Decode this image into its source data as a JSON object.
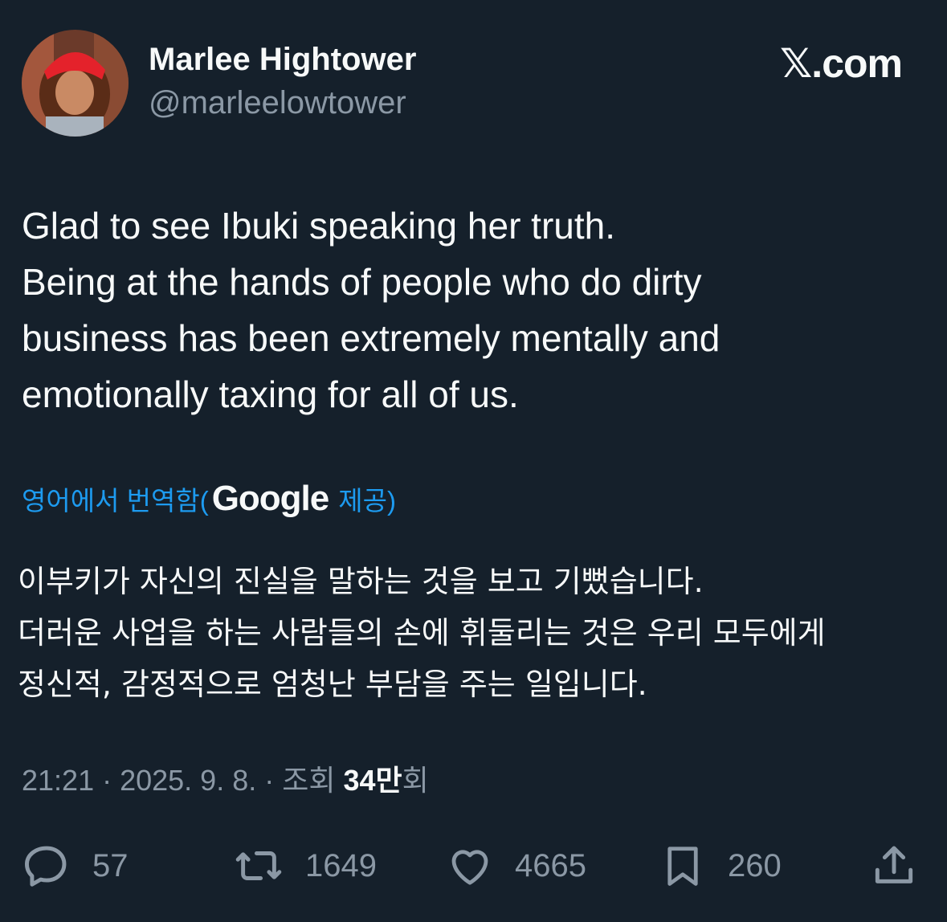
{
  "author": {
    "name": "Marlee Hightower",
    "handle": "@marleelowtower"
  },
  "brand": "𝕏.com",
  "tweet": {
    "lines": [
      "Glad to see Ibuki speaking her truth.",
      "Being at the hands of people who do dirty",
      "business has been extremely mentally and",
      "emotionally taxing for all of us."
    ]
  },
  "translation": {
    "prefix": "영어에서 번역함(",
    "provider": "Google",
    "suffix": "제공)",
    "lines": [
      "이부키가 자신의 진실을 말하는 것을 보고 기뻤습니다.",
      "더러운 사업을 하는 사람들의 손에 휘둘리는 것은 우리 모두에게",
      "정신적, 감정적으로 엄청난 부담을 주는 일입니다."
    ]
  },
  "meta": {
    "timestamp": "21:21 · 2025. 9. 8. · 조회",
    "views": "34만",
    "views_suffix": "회"
  },
  "actions": {
    "replies": "57",
    "reposts": "1649",
    "likes": "4665",
    "bookmarks": "260"
  },
  "icons": [
    "reply-icon",
    "repost-icon",
    "like-icon",
    "bookmark-icon",
    "share-icon"
  ],
  "colors": {
    "background": "#15202b",
    "text": "#f7f9f9",
    "secondary": "#8b98a5",
    "link": "#1d9bf0"
  }
}
